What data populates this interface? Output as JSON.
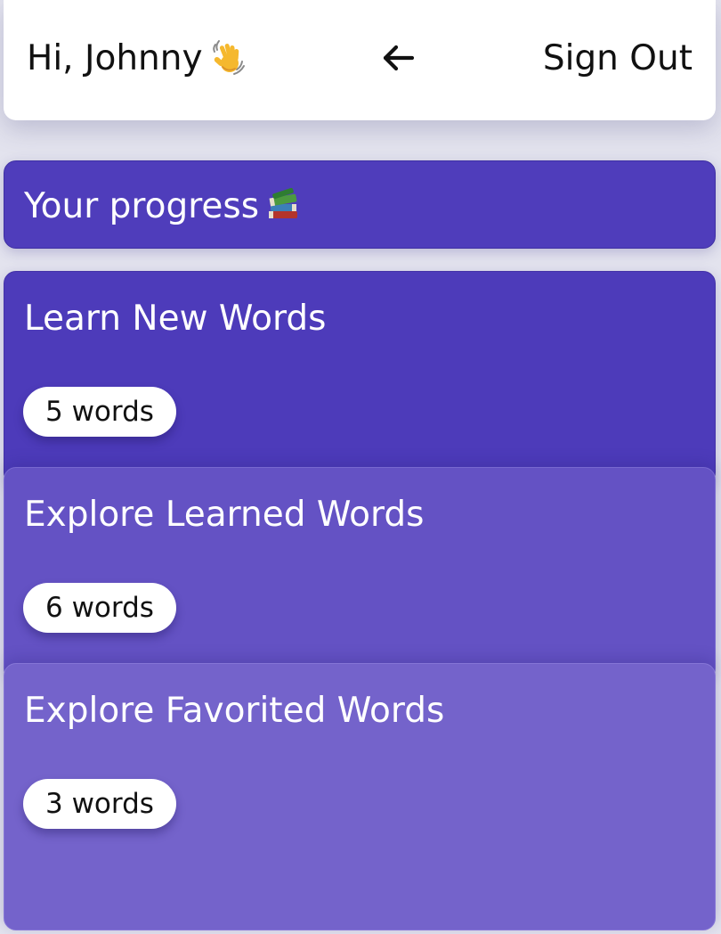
{
  "header": {
    "greeting": "Hi, Johnny",
    "greeting_icon": "waving-hand-icon",
    "back_icon": "arrow-left-icon",
    "sign_out_label": "Sign Out"
  },
  "progress": {
    "label": "Your progress",
    "icon": "books-icon"
  },
  "cards": [
    {
      "title": "Learn New Words",
      "count_label": "5 words"
    },
    {
      "title": "Explore Learned Words",
      "count_label": "6 words"
    },
    {
      "title": "Explore Favorited Words",
      "count_label": "3 words"
    }
  ],
  "colors": {
    "page_background": "#e3e3ee",
    "progress_background": "#4f3dbb",
    "card_learn": "#4d3bba",
    "card_explore": "#6452c4",
    "card_favorited": "#7463cb"
  }
}
